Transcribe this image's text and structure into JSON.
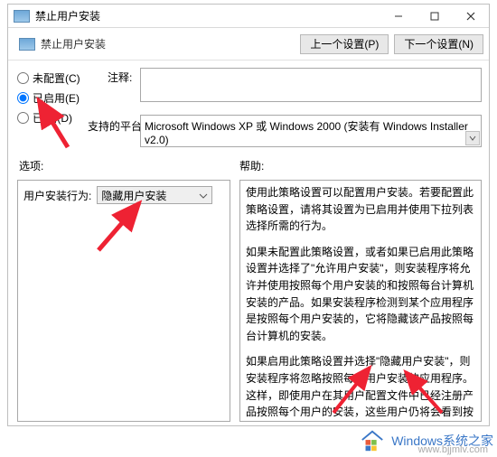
{
  "window": {
    "title": "禁止用户安装",
    "toolbar_title": "禁止用户安装",
    "prev_btn": "上一个设置(P)",
    "next_btn": "下一个设置(N)"
  },
  "radios": {
    "not_configured": "未配置(C)",
    "enabled": "已启用(E)",
    "disabled": "已   用(D)"
  },
  "labels": {
    "comment": "注释:",
    "platform": "支持的平台:",
    "options": "选项:",
    "help": "帮助:",
    "behavior": "用户安装行为:"
  },
  "values": {
    "platform_text": "Microsoft Windows XP 或 Windows 2000 (安装有 Windows Installer v2.0)",
    "combo_selected": "隐藏用户安装"
  },
  "help_text": {
    "p1": "使用此策略设置可以配置用户安装。若要配置此策略设置，请将其设置为已启用并使用下拉列表选择所需的行为。",
    "p2": "如果未配置此策略设置，或者如果已启用此策略设置并选择了\"允许用户安装\"，则安装程序将允许并使用按照每个用户安装的和按照每台计算机安装的产品。如果安装程序检测到某个应用程序是按照每个用户安装的，它将隐藏该产品按照每台计算机的安装。",
    "p3": "如果启用此策略设置并选择\"隐藏用户安装\"，则安装程序将忽略按照每个用户安装的应用程序。这样，即使用户在其用户配置文件中已经注册产品按照每个用户的安装，这些用户仍将会看到按照每台计算机安装的应用程序。"
  },
  "watermark": {
    "brand": "Windows系统之家",
    "url": "www.bjjmlv.com"
  }
}
